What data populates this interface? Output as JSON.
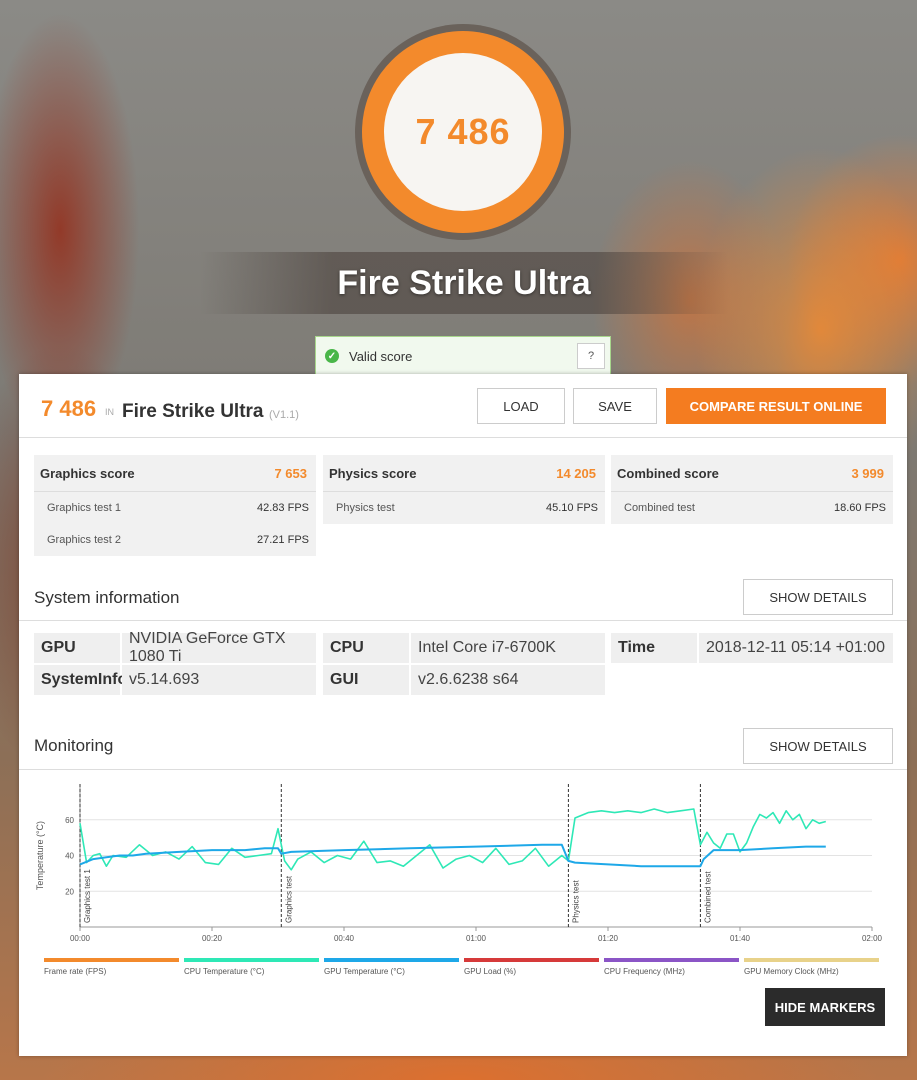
{
  "hero": {
    "score": "7 486",
    "title": "Fire Strike Ultra"
  },
  "valid": {
    "label": "Valid score",
    "help": "?"
  },
  "result": {
    "score": "7 486",
    "in_label": "IN",
    "name": "Fire Strike Ultra",
    "version": "(V1.1)"
  },
  "buttons": {
    "load": "LOAD",
    "save": "SAVE",
    "compare": "COMPARE RESULT ONLINE",
    "show_details": "SHOW DETAILS",
    "hide_markers": "HIDE MARKERS"
  },
  "scores": [
    {
      "label": "Graphics score",
      "value": "7 653",
      "tests": [
        {
          "label": "Graphics test 1",
          "value": "42.83 FPS"
        },
        {
          "label": "Graphics test 2",
          "value": "27.21 FPS"
        }
      ]
    },
    {
      "label": "Physics score",
      "value": "14 205",
      "tests": [
        {
          "label": "Physics test",
          "value": "45.10 FPS"
        }
      ]
    },
    {
      "label": "Combined score",
      "value": "3 999",
      "tests": [
        {
          "label": "Combined test",
          "value": "18.60 FPS"
        }
      ]
    }
  ],
  "system": {
    "title": "System information",
    "gpu_label": "GPU",
    "gpu": "NVIDIA GeForce GTX 1080 Ti",
    "cpu_label": "CPU",
    "cpu": "Intel Core i7-6700K",
    "time_label": "Time",
    "time": "2018-12-11 05:14 +01:00",
    "sysinfo_label": "SystemInfo",
    "sysinfo": "v5.14.693",
    "gui_label": "GUI",
    "gui": "v2.6.6238 s64"
  },
  "monitoring": {
    "title": "Monitoring"
  },
  "chart_data": {
    "type": "line",
    "ylabel": "Temperature (°C)",
    "y_ticks": [
      20,
      40,
      60
    ],
    "x_ticks": [
      "00:00",
      "00:20",
      "00:40",
      "01:00",
      "01:20",
      "01:40",
      "02:00"
    ],
    "xlim_seconds": [
      0,
      120
    ],
    "ylim": [
      0,
      80
    ],
    "markers": [
      {
        "label": "Graphics test 1",
        "t": 0
      },
      {
        "label": "Graphics test",
        "t": 30.5
      },
      {
        "label": "Physics test",
        "t": 74
      },
      {
        "label": "Combined test",
        "t": 94
      }
    ],
    "series": [
      {
        "name": "CPU Temperature (°C)",
        "color": "#2ee8b6",
        "t": [
          0,
          1,
          2,
          3,
          4,
          5,
          7,
          9,
          11,
          13,
          15,
          17,
          19,
          21,
          23,
          25,
          27,
          29,
          30,
          31,
          32,
          33,
          35,
          37,
          39,
          41,
          43,
          45,
          47,
          49,
          51,
          53,
          55,
          57,
          59,
          61,
          63,
          65,
          67,
          69,
          71,
          73,
          74,
          75,
          77,
          79,
          81,
          83,
          85,
          87,
          89,
          91,
          93,
          94,
          95,
          96,
          97,
          98,
          99,
          100,
          101,
          102,
          103,
          104,
          105,
          106,
          107,
          108,
          109,
          110,
          111,
          112,
          113
        ],
        "v": [
          58,
          36,
          40,
          41,
          34,
          40,
          39,
          46,
          40,
          42,
          38,
          45,
          36,
          35,
          44,
          39,
          40,
          41,
          55,
          37,
          32,
          38,
          42,
          36,
          40,
          38,
          48,
          36,
          37,
          34,
          40,
          46,
          33,
          38,
          40,
          36,
          44,
          35,
          37,
          44,
          34,
          40,
          37,
          61,
          64,
          65,
          64,
          65,
          64,
          66,
          64,
          65,
          66,
          46,
          53,
          47,
          44,
          52,
          52,
          42,
          47,
          56,
          63,
          61,
          64,
          58,
          65,
          60,
          63,
          55,
          60,
          58,
          59
        ]
      },
      {
        "name": "GPU Temperature (°C)",
        "color": "#1ea8e8",
        "t": [
          0,
          2,
          4,
          6,
          8,
          10,
          15,
          20,
          25,
          28,
          30,
          30.5,
          32,
          40,
          50,
          60,
          70,
          73,
          74,
          75,
          80,
          85,
          90,
          94,
          94.5,
          96,
          100,
          105,
          110,
          113
        ],
        "v": [
          35,
          38,
          39,
          40,
          40,
          41,
          42,
          43,
          43,
          44,
          44,
          41,
          42,
          43,
          44,
          45,
          46,
          46,
          37,
          36,
          35,
          34,
          34,
          34,
          38,
          43,
          43,
          44,
          45,
          45
        ]
      }
    ],
    "legend": [
      {
        "name": "Frame rate (FPS)",
        "color": "#f38a2c"
      },
      {
        "name": "CPU Temperature (°C)",
        "color": "#2ee8b6"
      },
      {
        "name": "GPU Temperature (°C)",
        "color": "#1ea8e8"
      },
      {
        "name": "GPU Load (%)",
        "color": "#d63a3a"
      },
      {
        "name": "CPU Frequency (MHz)",
        "color": "#8b55c6"
      },
      {
        "name": "GPU Memory Clock (MHz)",
        "color": "#e8d28a"
      }
    ]
  }
}
